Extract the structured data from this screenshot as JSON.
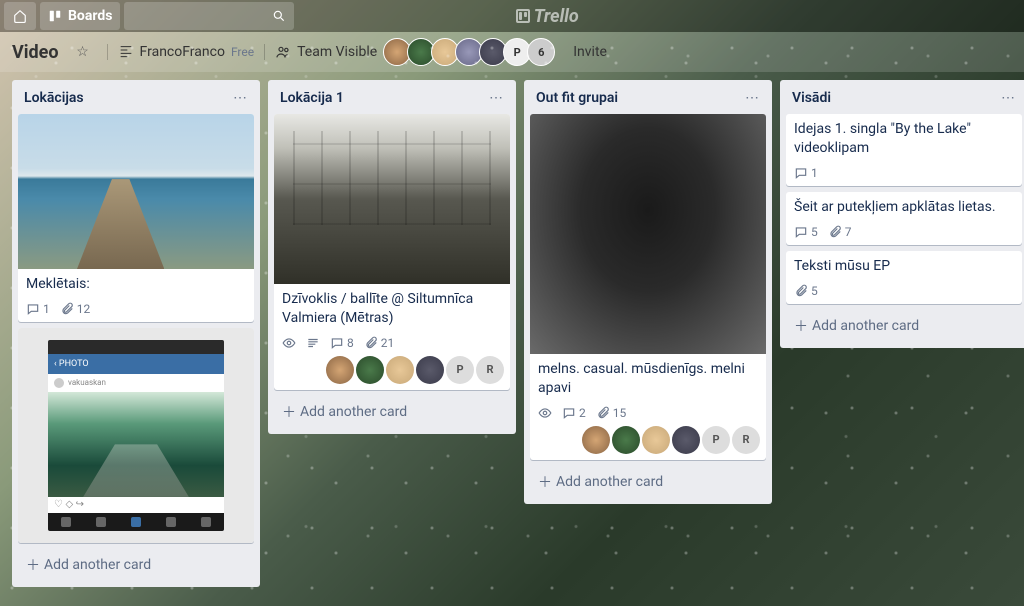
{
  "topbar": {
    "boards_label": "Boards",
    "logo_text": "Trello"
  },
  "board_header": {
    "name": "Video",
    "team_name": "FrancoFranco",
    "plan": "Free",
    "visibility": "Team Visible",
    "invite_label": "Invite",
    "extra_avatar_p": "P",
    "extra_count": "6"
  },
  "lists": [
    {
      "title": "Lokācijas",
      "cards": [
        {
          "title": "Meklētais:",
          "comments": "1",
          "attachments": "12"
        },
        {
          "title": ""
        }
      ],
      "add_label": "Add another card"
    },
    {
      "title": "Lokācija 1",
      "cards": [
        {
          "title": "Dzīvoklis / ballīte @ Siltumnīca Valmiera (Mētras)",
          "comments": "8",
          "attachments": "21",
          "members_p": "P",
          "members_r": "R"
        }
      ],
      "add_label": "Add another card"
    },
    {
      "title": "Out fit grupai",
      "cards": [
        {
          "title": "melns. casual. mūsdienīgs. melni apavi",
          "comments": "2",
          "attachments": "15",
          "members_p": "P",
          "members_r": "R"
        }
      ],
      "add_label": "Add another card"
    },
    {
      "title": "Visādi",
      "cards": [
        {
          "title": "Idejas 1. singla \"By the Lake\" videoklipam",
          "comments": "1"
        },
        {
          "title": "Šeit ar putekļiem apklātas lietas.",
          "comments": "5",
          "attachments": "7"
        },
        {
          "title": "Teksti mūsu EP",
          "attachments": "5"
        }
      ],
      "add_label": "Add another card"
    }
  ],
  "icons": {
    "comment": "💬",
    "attach": "📎",
    "eye": "👁",
    "desc": "≣"
  }
}
